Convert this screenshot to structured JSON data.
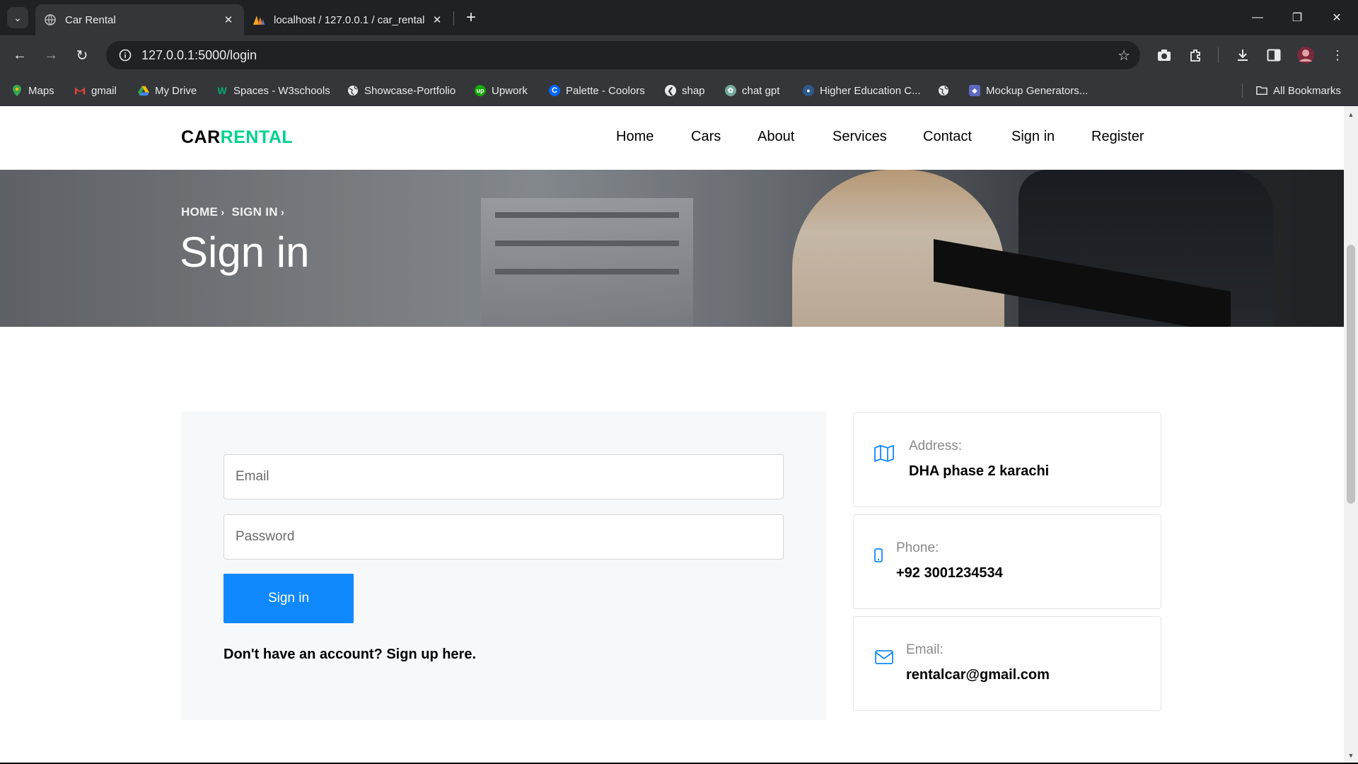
{
  "browser": {
    "tabs": [
      {
        "title": "Car Rental",
        "active": true
      },
      {
        "title": "localhost / 127.0.0.1 / car_rental",
        "active": false
      }
    ],
    "url": "127.0.0.1:5000/login",
    "bookmarks": [
      {
        "label": "Maps",
        "icon": "maps-icon",
        "color": "#34a853"
      },
      {
        "label": "gmail",
        "icon": "gmail-icon",
        "color": "#ea4335"
      },
      {
        "label": "My Drive",
        "icon": "drive-icon",
        "color": "#fbbc04"
      },
      {
        "label": "Spaces - W3schools",
        "icon": "w3schools-icon",
        "color": "#04aa6d"
      },
      {
        "label": "Showcase-Portfolio",
        "icon": "globe-icon",
        "color": "#9aa0a6"
      },
      {
        "label": "Upwork",
        "icon": "upwork-icon",
        "color": "#14a800"
      },
      {
        "label": "Palette - Coolors",
        "icon": "coolors-icon",
        "color": "#0066ff"
      },
      {
        "label": "shap",
        "icon": "shap-icon",
        "color": "#9aa0a6"
      },
      {
        "label": "chat gpt",
        "icon": "chatgpt-icon",
        "color": "#74aa9c"
      },
      {
        "label": "Higher Education C...",
        "icon": "education-icon",
        "color": "#2e7d32"
      },
      {
        "label": "",
        "icon": "globe-icon",
        "color": "#9aa0a6"
      },
      {
        "label": "Mockup Generators...",
        "icon": "mockup-icon",
        "color": "#5c6bc0"
      }
    ],
    "all_bookmarks": "All Bookmarks"
  },
  "site": {
    "logo_part1": "CAR",
    "logo_part2": "RENTAL",
    "brand_color": "#01d28e",
    "nav": [
      "Home",
      "Cars",
      "About",
      "Services",
      "Contact",
      "Sign in",
      "Register"
    ]
  },
  "hero": {
    "breadcrumb": [
      "HOME",
      "SIGN IN"
    ],
    "title": "Sign in"
  },
  "form": {
    "email_placeholder": "Email",
    "password_placeholder": "Password",
    "submit_label": "Sign in",
    "accent_color": "#1089ff",
    "signup_text": "Don't have an account? Sign up here."
  },
  "contact": [
    {
      "icon": "map-icon",
      "label": "Address:",
      "value": "DHA phase 2 karachi"
    },
    {
      "icon": "phone-icon",
      "label": "Phone:",
      "value": "+92 3001234534"
    },
    {
      "icon": "mail-icon",
      "label": "Email:",
      "value": "rentalcar@gmail.com"
    }
  ]
}
